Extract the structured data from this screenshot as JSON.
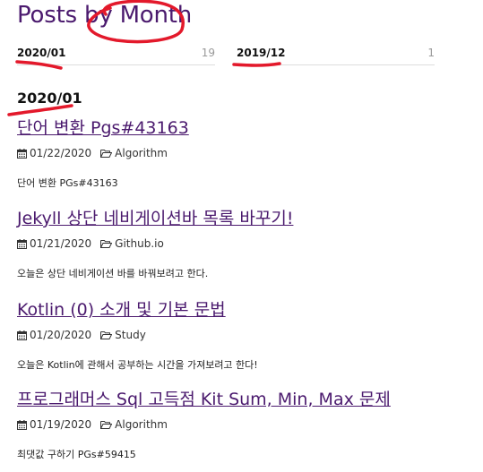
{
  "page": {
    "title": "Posts by Month"
  },
  "month_tabs": [
    {
      "label": "2020/01",
      "count": "19"
    },
    {
      "label": "2019/12",
      "count": "1"
    }
  ],
  "section": {
    "heading": "2020/01"
  },
  "posts": [
    {
      "title": "단어 변환 Pgs#43163",
      "date": "01/22/2020",
      "category": "Algorithm",
      "excerpt": "단어 변환 PGs#43163"
    },
    {
      "title": "Jekyll 상단 네비게이션바 목록 바꾸기!",
      "date": "01/21/2020",
      "category": "Github.io",
      "excerpt": "오늘은 상단 네비게이션 바를 바꿔보려고 한다."
    },
    {
      "title": "Kotlin (0) 소개 및 기본 문법",
      "date": "01/20/2020",
      "category": "Study",
      "excerpt": "오늘은 Kotlin에 관해서 공부하는 시간을 가져보려고 한다!"
    },
    {
      "title": "프로그래머스 Sql 고득점 Kit Sum, Min, Max 문제",
      "date": "01/19/2020",
      "category": "Algorithm",
      "excerpt": "최댓값 구하기 PGs#59415"
    }
  ],
  "icons": {
    "date": "calendar-icon",
    "category": "folder-open-icon"
  },
  "colors": {
    "accent": "#4b1a6e",
    "annotation": "#e3192b"
  }
}
